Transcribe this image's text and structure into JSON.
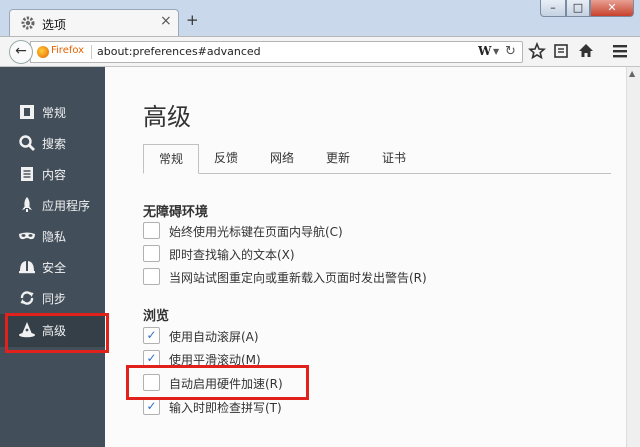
{
  "window": {
    "tab_title": "选项",
    "new_tab": "+",
    "tab_close": "×",
    "controls": {
      "minimize": "–",
      "maximize": "□",
      "close": "✕"
    }
  },
  "navbar": {
    "back": "←",
    "identity": "Firefox",
    "url": "about:preferences#advanced",
    "search_engine": "W",
    "dropdown": "▼",
    "reload": "↻",
    "icons": [
      "star-icon",
      "reading-list-icon",
      "home-icon",
      "menu-icon"
    ]
  },
  "sidebar": {
    "items": [
      {
        "label": "常规",
        "icon": "general-icon"
      },
      {
        "label": "搜索",
        "icon": "search-icon"
      },
      {
        "label": "内容",
        "icon": "content-icon"
      },
      {
        "label": "应用程序",
        "icon": "rocket-icon"
      },
      {
        "label": "隐私",
        "icon": "mask-icon"
      },
      {
        "label": "安全",
        "icon": "helmet-icon"
      },
      {
        "label": "同步",
        "icon": "sync-icon"
      },
      {
        "label": "高级",
        "icon": "wizard-hat-icon",
        "active": true
      }
    ]
  },
  "main": {
    "title": "高级",
    "tabs": [
      {
        "label": "常规",
        "selected": true
      },
      {
        "label": "反馈"
      },
      {
        "label": "网络"
      },
      {
        "label": "更新"
      },
      {
        "label": "证书"
      }
    ],
    "accessibility": {
      "title": "无障碍环境",
      "options": [
        {
          "label": "始终使用光标键在页面内导航(C)",
          "checked": false
        },
        {
          "label": "即时查找输入的文本(X)",
          "checked": false
        },
        {
          "label": "当网站试图重定向或重新载入页面时发出警告(R)",
          "checked": false
        }
      ]
    },
    "browsing": {
      "title": "浏览",
      "options": [
        {
          "label": "使用自动滚屏(A)",
          "checked": true
        },
        {
          "label": "使用平滑滚动(M)",
          "checked": true
        },
        {
          "label": "自动启用硬件加速(R)",
          "checked": false
        },
        {
          "label": "输入时即检查拼写(T)",
          "checked": true
        }
      ]
    }
  },
  "checkmark": "✓",
  "colors": {
    "highlight": "#e0211c",
    "sidebar_bg": "#424f5a",
    "accent": "#2f6ec9"
  }
}
